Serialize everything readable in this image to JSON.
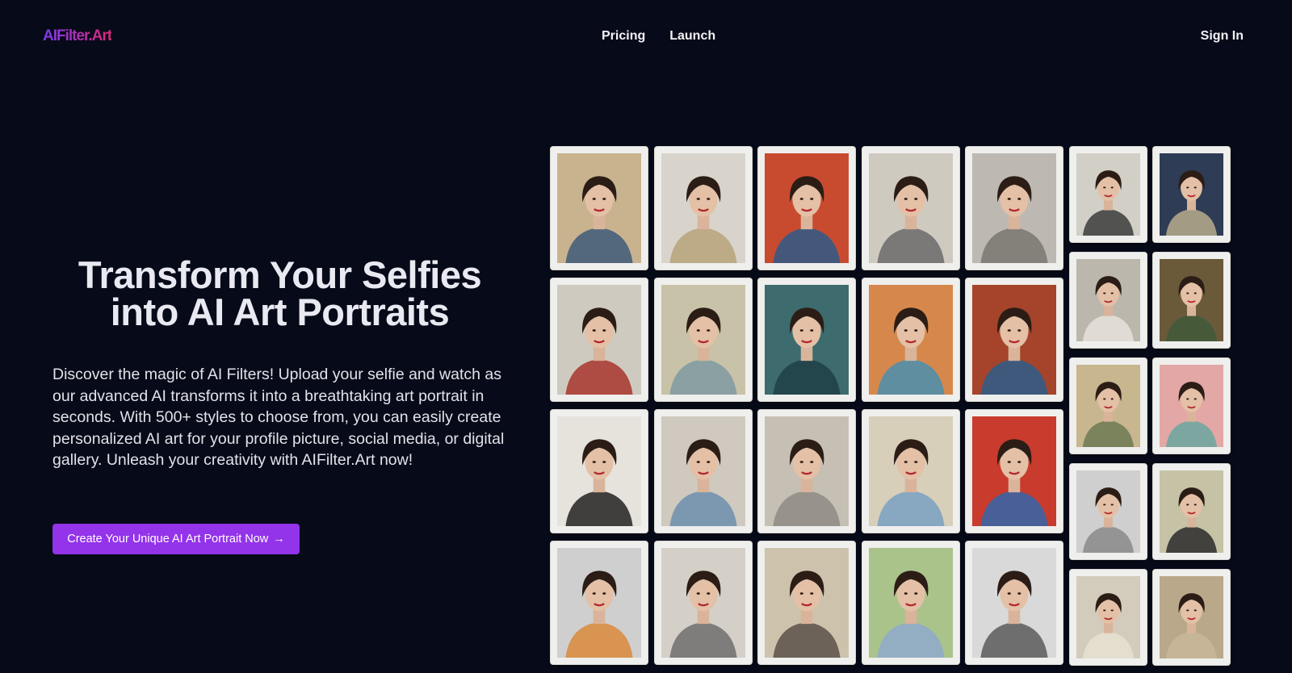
{
  "header": {
    "logo": "AIFilter.Art",
    "nav": [
      "Pricing",
      "Launch"
    ],
    "sign_in": "Sign In"
  },
  "hero": {
    "title_line1": "Transform Your Selfies",
    "title_line2": "into AI Art Portraits",
    "description": "Discover the magic of AI Filters! Upload your selfie and watch as our advanced AI transforms it into a breathtaking art portrait in seconds. With 500+ styles to choose from, you can easily create personalized AI art for your profile picture, social media, or digital gallery. Unleash your creativity with AIFilter.Art now!",
    "cta_label": "Create Your Unique AI Art Portrait Now",
    "cta_arrow": "→"
  },
  "colors": {
    "background": "#070a18",
    "accent": "#9333ea",
    "logo_gradient": [
      "#7c3aed",
      "#db2777"
    ]
  },
  "gallery": {
    "large_columns": [
      [
        "#c9b38f|#3e5a7a",
        "#d8d4cc|#b9a27a",
        "#c94b2f|#2e5b8a",
        "#cfcac0|#6b6b6b",
        "#bdb9b2|#7a7670"
      ],
      [
        "#cfcac0|#a8352c",
        "#c8c2a8|#7f9aa2",
        "#3d6b6e|#1f3f47",
        "#d6884c|#4a8fb0",
        "#a5442a|#2d5d8c"
      ],
      [
        "#e6e3dd|#222222",
        "#cfc9bf|#6d8fad",
        "#c6bfb3|#8e8a84",
        "#d7cfba|#7aa0c2",
        "#c83b2d|#3366aa"
      ],
      [
        "#cfcfcf|#d98a3a",
        "#d4d0c8|#6e6e6e",
        "#cdc3ad|#5a5148",
        "#a9c38a|#8fa9cc",
        "#d9d9d9|#5a5a5a"
      ]
    ],
    "small_columns": [
      [
        "#d2cfc6|#3c3c3c",
        "#bbb7ad|#e6e2da",
        "#c8b68f|#6d7a55",
        "#cfcfcf|#8a8a8a",
        "#d3ccbd|#e6e0d2"
      ],
      [
        "#2e3c55|#b9ac8e",
        "#6b5a3a|#3f5a3a",
        "#e3a7a5|#6aa7a0",
        "#c6c2a6|#2a2a2a",
        "#b9a98a|#c9b79a"
      ]
    ]
  }
}
